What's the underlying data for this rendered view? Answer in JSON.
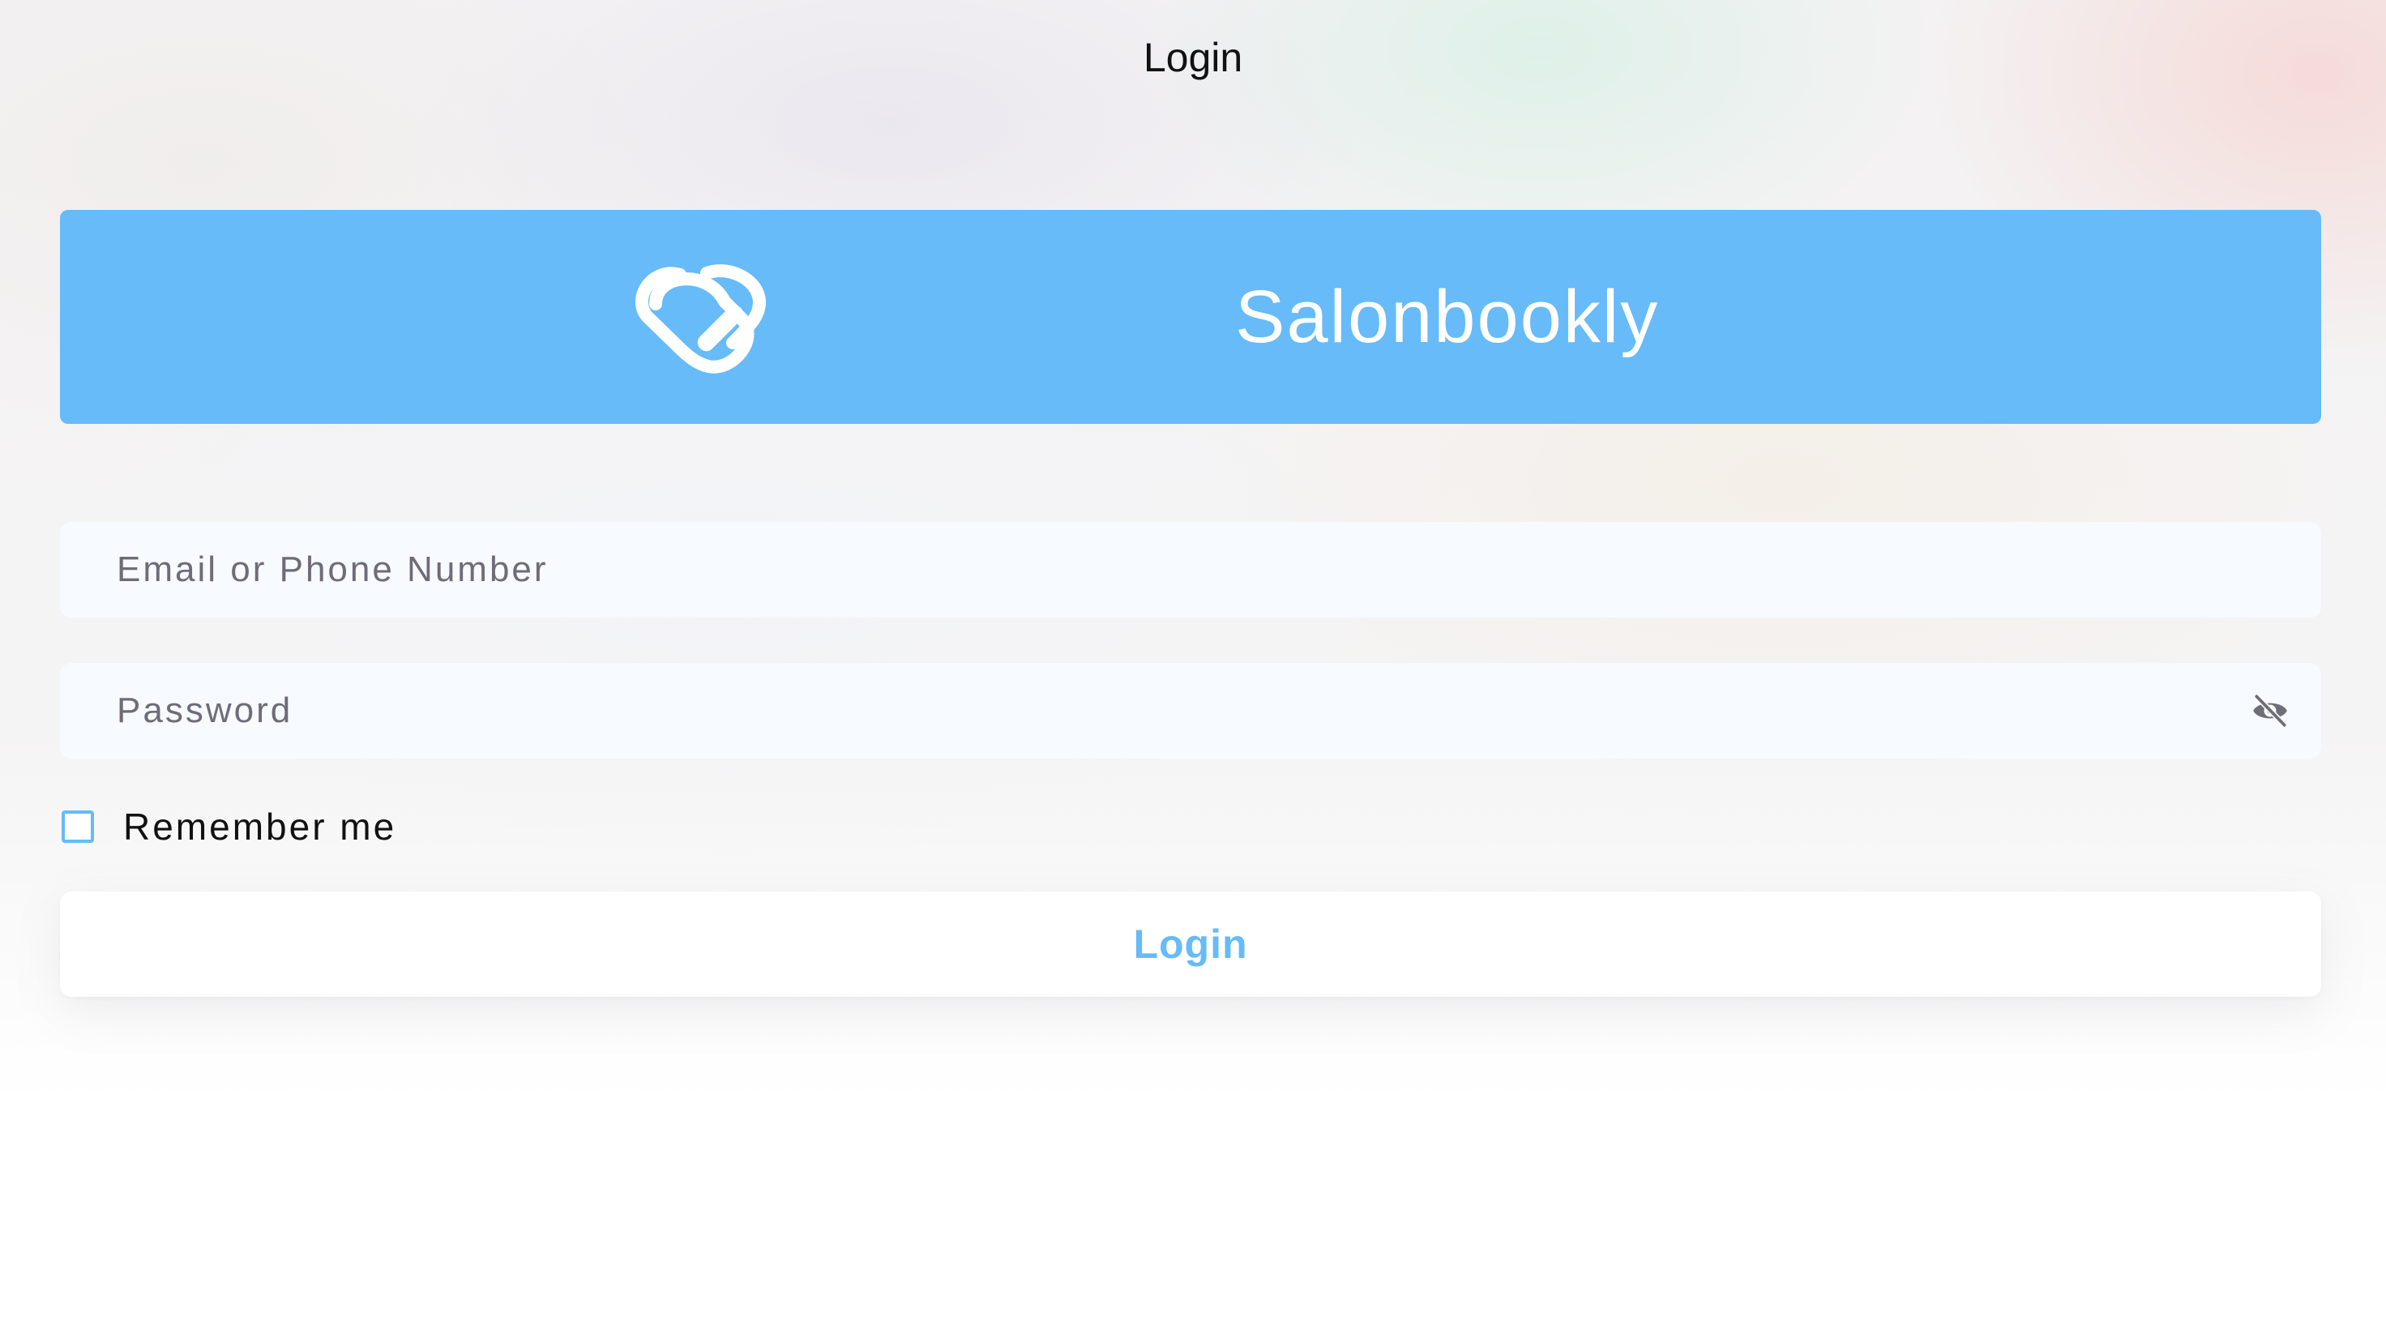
{
  "header": {
    "title": "Login"
  },
  "brand": {
    "name": "Salonbookly",
    "logo_icon": "heart-infinity-icon",
    "color": "#66bbf8"
  },
  "form": {
    "email": {
      "placeholder": "Email or Phone Number",
      "value": ""
    },
    "password": {
      "placeholder": "Password",
      "value": "",
      "toggle_icon": "eye-off-icon"
    },
    "remember": {
      "label": "Remember me",
      "checked": false
    },
    "submit_label": "Login"
  },
  "colors": {
    "accent": "#66bbf8",
    "input_bg": "#f7faff",
    "placeholder": "#6f6b7a",
    "title_text": "#111111"
  }
}
